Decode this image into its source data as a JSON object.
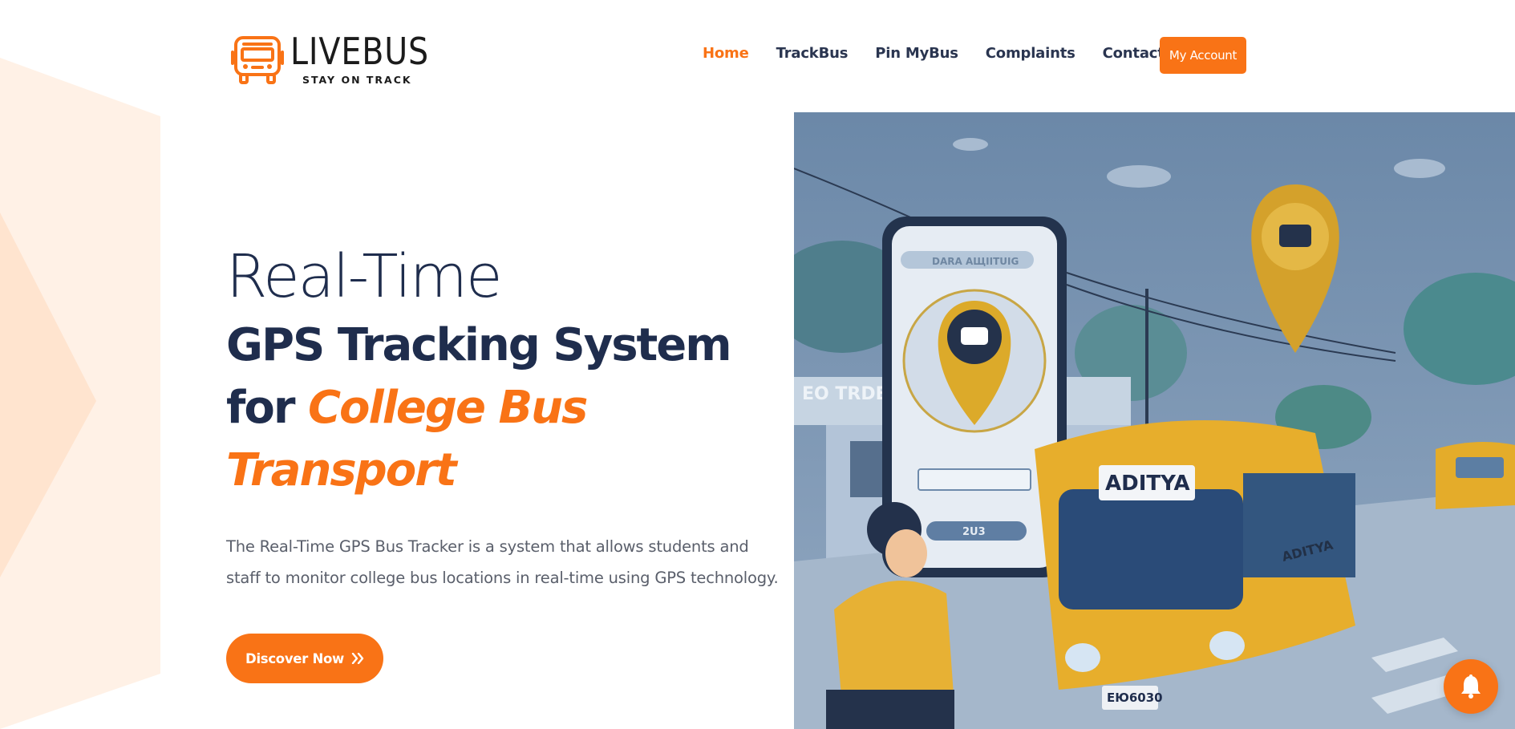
{
  "brand": {
    "name": "LIVEBUS",
    "tagline": "STAY ON TRACK",
    "logo_icon": "bus-icon",
    "accent_color": "#f97316",
    "text_color": "#1f2d4d"
  },
  "nav": {
    "items": [
      {
        "label": "Home",
        "active": true
      },
      {
        "label": "TrackBus",
        "active": false
      },
      {
        "label": "Pin MyBus",
        "active": false
      },
      {
        "label": "Complaints",
        "active": false
      },
      {
        "label": "Contact",
        "active": false
      }
    ],
    "account_label": "My Account"
  },
  "hero": {
    "line1": "Real-Time",
    "line2": "GPS Tracking System",
    "line3_prefix": "for ",
    "line3_accent": "College Bus Transport",
    "description": "The Real-Time GPS Bus Tracker is a system that allows students and staff to monitor college bus locations in real-time using GPS technology.",
    "cta_label": "Discover Now",
    "cta_icon": "double-chevron-right-icon"
  },
  "illustration": {
    "phone_header_text": "DARA AЩIITUIG",
    "phone_bottom_text": "2U3",
    "station_sign": "EO TRDE",
    "bus_sign": "ADITYA",
    "bus_side_text": "ADITYA",
    "bus_plate": "ЕЮ6030"
  },
  "notification": {
    "icon": "bell-icon"
  }
}
